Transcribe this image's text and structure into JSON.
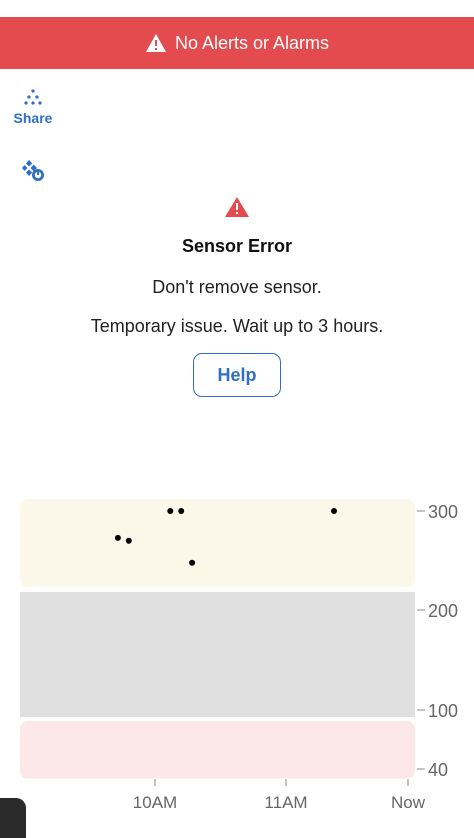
{
  "alert_banner": {
    "text": "No Alerts or Alarms",
    "icon": "warning-triangle-icon",
    "background": "#e34b4f"
  },
  "share": {
    "label": "Share",
    "icon": "share-dots-icon"
  },
  "sensor_status_icon": "sensor-error-icon",
  "error": {
    "icon": "warning-triangle-icon",
    "title": "Sensor Error",
    "line1": "Don't remove sensor.",
    "line2": "Temporary issue. Wait up to 3 hours.",
    "help_label": "Help"
  },
  "colors": {
    "accent": "#2f6fc4",
    "alert_red": "#e34b4f",
    "high_zone": "#fbf8e9",
    "target_zone": "#e0e0e0",
    "low_zone": "#fce8e8"
  },
  "chart_data": {
    "type": "scatter",
    "y_ticks": [
      "300",
      "200",
      "100",
      "40"
    ],
    "x_ticks": [
      "10AM",
      "11AM",
      "Now"
    ],
    "ylim": [
      40,
      300
    ],
    "points": [
      {
        "x": "9:43",
        "y": 273
      },
      {
        "x": "9:48",
        "y": 270
      },
      {
        "x": "10:07",
        "y": 300
      },
      {
        "x": "10:12",
        "y": 300
      },
      {
        "x": "10:17",
        "y": 248
      },
      {
        "x": "11:22",
        "y": 300
      }
    ]
  }
}
